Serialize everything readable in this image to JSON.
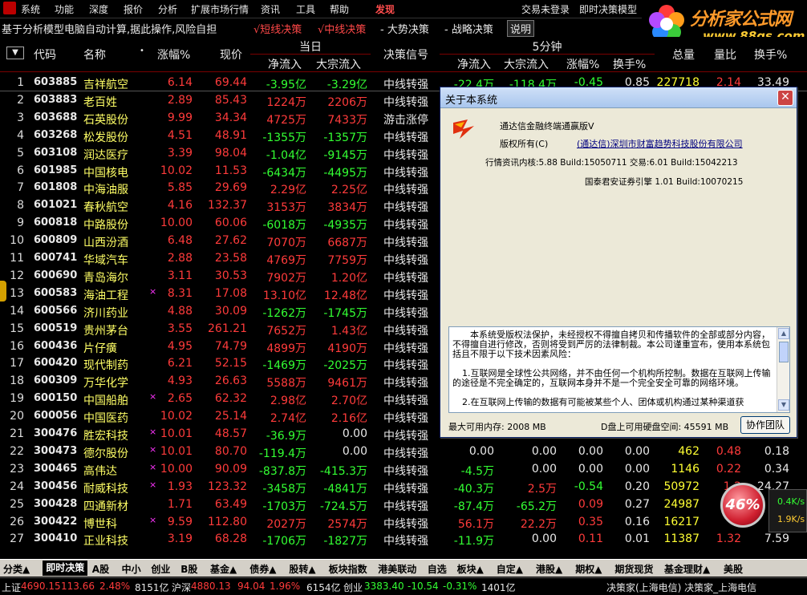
{
  "menu": [
    "系统",
    "功能",
    "深度",
    "报价",
    "分析",
    "扩展市场行情",
    "资讯",
    "工具",
    "帮助",
    "发现",
    "交易未登录",
    "即时决策模型"
  ],
  "ticker": {
    "text": "基于分析模型电脑自动计算,据此操作,风险自担",
    "short": "√短线决策",
    "mid": "√中线决策",
    "trend": "- 大势决策",
    "strategy": "- 战略决策",
    "explain": "说明"
  },
  "logo": {
    "title": "分析家公式网",
    "url": "www.88gs.com"
  },
  "header": {
    "code": "代码",
    "name": "名称",
    "pct": "涨幅%",
    "price": "现价",
    "group_today": "当日",
    "net_in": "净流入",
    "big_in": "大宗流入",
    "signal": "决策信号",
    "group_5min": "5分钟",
    "net_in_5": "净流入",
    "big_in_5": "大宗流入",
    "pct_5": "涨幅%",
    "turn_5": "换手%",
    "total": "总量",
    "vol_ratio": "量比",
    "turnover": "换手%"
  },
  "rows": [
    {
      "idx": "1",
      "code": "603885",
      "name": "吉祥航空",
      "mark": "",
      "pct": "6.14",
      "price": "69.44",
      "net": "-3.95亿",
      "big": "-3.29亿",
      "sig": "中线转强",
      "f1": "-22.4万",
      "f2": "-118.4万",
      "f3": "-0.45",
      "f4": "0.85",
      "f5": "227718",
      "f6": "2.14",
      "f7": "33.49"
    },
    {
      "idx": "2",
      "code": "603883",
      "name": "老百姓",
      "mark": "",
      "pct": "2.89",
      "price": "85.43",
      "net": "1224万",
      "big": "2206万",
      "sig": "中线转强"
    },
    {
      "idx": "3",
      "code": "603688",
      "name": "石英股份",
      "mark": "",
      "pct": "9.99",
      "price": "34.34",
      "net": "4725万",
      "big": "7433万",
      "sig": "游击涨停"
    },
    {
      "idx": "4",
      "code": "603268",
      "name": "松发股份",
      "mark": "",
      "pct": "4.51",
      "price": "48.91",
      "net": "-1355万",
      "big": "-1357万",
      "sig": "中线转强"
    },
    {
      "idx": "5",
      "code": "603108",
      "name": "润达医疗",
      "mark": "",
      "pct": "3.39",
      "price": "98.04",
      "net": "-1.04亿",
      "big": "-9145万",
      "sig": "中线转强"
    },
    {
      "idx": "6",
      "code": "601985",
      "name": "中国核电",
      "mark": "",
      "pct": "10.02",
      "price": "11.53",
      "net": "-6434万",
      "big": "-4495万",
      "sig": "中线转强"
    },
    {
      "idx": "7",
      "code": "601808",
      "name": "中海油服",
      "mark": "",
      "pct": "5.85",
      "price": "29.69",
      "net": "2.29亿",
      "big": "2.25亿",
      "sig": "中线转强"
    },
    {
      "idx": "8",
      "code": "601021",
      "name": "春秋航空",
      "mark": "",
      "pct": "4.16",
      "price": "132.37",
      "net": "3153万",
      "big": "3834万",
      "sig": "中线转强"
    },
    {
      "idx": "9",
      "code": "600818",
      "name": "中路股份",
      "mark": "",
      "pct": "10.00",
      "price": "60.06",
      "net": "-6018万",
      "big": "-4935万",
      "sig": "中线转强"
    },
    {
      "idx": "10",
      "code": "600809",
      "name": "山西汾酒",
      "mark": "",
      "pct": "6.48",
      "price": "27.62",
      "net": "7070万",
      "big": "6687万",
      "sig": "中线转强"
    },
    {
      "idx": "11",
      "code": "600741",
      "name": "华域汽车",
      "mark": "",
      "pct": "2.88",
      "price": "23.58",
      "net": "4769万",
      "big": "7759万",
      "sig": "中线转强"
    },
    {
      "idx": "12",
      "code": "600690",
      "name": "青岛海尔",
      "mark": "",
      "pct": "3.11",
      "price": "30.53",
      "net": "7902万",
      "big": "1.20亿",
      "sig": "中线转强"
    },
    {
      "idx": "13",
      "code": "600583",
      "name": "海油工程",
      "mark": "×",
      "pct": "8.31",
      "price": "17.08",
      "net": "13.10亿",
      "big": "12.48亿",
      "sig": "中线转强"
    },
    {
      "idx": "14",
      "code": "600566",
      "name": "济川药业",
      "mark": "",
      "pct": "4.88",
      "price": "30.09",
      "net": "-1262万",
      "big": "-1745万",
      "sig": "中线转强"
    },
    {
      "idx": "15",
      "code": "600519",
      "name": "贵州茅台",
      "mark": "",
      "pct": "3.55",
      "price": "261.21",
      "net": "7652万",
      "big": "1.43亿",
      "sig": "中线转强"
    },
    {
      "idx": "16",
      "code": "600436",
      "name": "片仔癀",
      "mark": "",
      "pct": "4.95",
      "price": "74.79",
      "net": "4899万",
      "big": "4190万",
      "sig": "中线转强"
    },
    {
      "idx": "17",
      "code": "600420",
      "name": "现代制药",
      "mark": "",
      "pct": "6.21",
      "price": "52.15",
      "net": "-1469万",
      "big": "-2025万",
      "sig": "中线转强"
    },
    {
      "idx": "18",
      "code": "600309",
      "name": "万华化学",
      "mark": "",
      "pct": "4.93",
      "price": "26.63",
      "net": "5588万",
      "big": "9461万",
      "sig": "中线转强"
    },
    {
      "idx": "19",
      "code": "600150",
      "name": "中国船舶",
      "mark": "×",
      "pct": "2.65",
      "price": "62.32",
      "net": "2.98亿",
      "big": "2.70亿",
      "sig": "中线转强"
    },
    {
      "idx": "20",
      "code": "600056",
      "name": "中国医药",
      "mark": "",
      "pct": "10.02",
      "price": "25.14",
      "net": "2.74亿",
      "big": "2.16亿",
      "sig": "中线转强"
    },
    {
      "idx": "21",
      "code": "300476",
      "name": "胜宏科技",
      "mark": "×",
      "pct": "10.01",
      "price": "48.57",
      "net": "-36.9万",
      "big": "0.00",
      "sig": "中线转强"
    },
    {
      "idx": "22",
      "code": "300473",
      "name": "德尔股份",
      "mark": "×",
      "pct": "10.01",
      "price": "80.70",
      "net": "-119.4万",
      "big": "0.00",
      "sig": "中线转强",
      "f1": "0.00",
      "f2": "0.00",
      "f3": "0.00",
      "f4": "0.00",
      "f5": "462",
      "f6": "0.48",
      "f7": "0.18"
    },
    {
      "idx": "23",
      "code": "300465",
      "name": "高伟达",
      "mark": "×",
      "pct": "10.00",
      "price": "90.09",
      "net": "-837.8万",
      "big": "-415.3万",
      "sig": "中线转强",
      "f1": "-4.5万",
      "f2": "0.00",
      "f3": "0.00",
      "f4": "0.00",
      "f5": "1146",
      "f6": "0.22",
      "f7": "0.34"
    },
    {
      "idx": "24",
      "code": "300456",
      "name": "耐威科技",
      "mark": "×",
      "pct": "1.93",
      "price": "123.32",
      "net": "-3458万",
      "big": "-4841万",
      "sig": "中线转强",
      "f1": "-40.3万",
      "f2": "2.5万",
      "f3": "-0.54",
      "f4": "0.20",
      "f5": "50972",
      "f6": "1.2",
      "f7": "24.27"
    },
    {
      "idx": "25",
      "code": "300428",
      "name": "四通新材",
      "mark": "",
      "pct": "1.71",
      "price": "63.49",
      "net": "-1703万",
      "big": "-724.5万",
      "sig": "中线转强",
      "f1": "-87.4万",
      "f2": "-65.2万",
      "f3": "0.09",
      "f4": "0.27",
      "f5": "24987",
      "f6": "",
      "f7": ""
    },
    {
      "idx": "26",
      "code": "300422",
      "name": "博世科",
      "mark": "×",
      "pct": "9.59",
      "price": "112.80",
      "net": "2027万",
      "big": "2574万",
      "sig": "中线转强",
      "f1": "56.1万",
      "f2": "22.2万",
      "f3": "0.35",
      "f4": "0.16",
      "f5": "16217",
      "f6": "",
      "f7": ""
    },
    {
      "idx": "27",
      "code": "300410",
      "name": "正业科技",
      "mark": "",
      "pct": "3.19",
      "price": "68.28",
      "net": "-1706万",
      "big": "-1827万",
      "sig": "中线转强",
      "f1": "-11.9万",
      "f2": "0.00",
      "f3": "0.11",
      "f4": "0.01",
      "f5": "11387",
      "f6": "1.32",
      "f7": "7.59"
    }
  ],
  "dialog": {
    "title": "关于本系统",
    "product": "通达信金融终端通赢版V",
    "copyright_label": "版权所有(C)",
    "company": "(通达信)深圳市财富趋势科技股份有限公司",
    "kernel": "行情资讯内核:5.88 Build:15050711 交易:6.01 Build:15042213",
    "engine": "国泰君安证券引擎 1.01 Build:10070215",
    "text1": "本系统受版权法保护，未经授权不得擅自拷贝和传播软件的全部或部分内容，不得擅自进行修改，否则将受到严厉的法律制裁。本公司谨重宣布，使用本系统包括且不限于以下技术因素风险：",
    "text2": "1.互联网是全球性公共网络，并不由任何一个机构所控制。数据在互联网上传输的途径是不完全确定的，互联网本身并不是一个完全安全可靠的网络环境。",
    "text3": "2.在互联网上传输的数据有可能被某些个人、团体或机构通过某种渠道获",
    "memory": "最大可用内存: 2008 MB",
    "disk": "D盘上可用硬盘空间: 45591 MB",
    "button": "协作团队"
  },
  "gauge": {
    "value": "46%",
    "up": "0.4",
    "down": "1.9",
    "unit": "K/s"
  },
  "tabs": [
    "分类▲",
    "即时决策",
    "A股",
    "中小",
    "创业",
    "B股",
    "基金▲",
    "债券▲",
    "股转▲",
    "板块指数",
    "港美联动",
    "自选",
    "板块▲",
    "自定▲",
    "港股▲",
    "期权▲",
    "期货现货",
    "基金理财▲",
    "美股"
  ],
  "status": {
    "sh_label": "上证",
    "sh_val": "4690.15",
    "sh_chg": "113.66",
    "sh_pct": "2.48%",
    "sh_amt": "8151亿",
    "hs_label": "沪深",
    "hs_val": "4880.13",
    "hs_chg": "94.04",
    "hs_pct": "1.96%",
    "hs_amt": "6154亿",
    "cy_label": "创业",
    "cy_val": "3383.40",
    "cy_chg": "-10.54",
    "cy_pct": "-0.31%",
    "cy_amt": "1401亿",
    "right": "决策家(上海电信) 决策家_上海电信"
  },
  "colors": {
    "up": "#ff3b3b",
    "down": "#33ff33",
    "name": "#ffff66",
    "accent": "#7a0000"
  }
}
